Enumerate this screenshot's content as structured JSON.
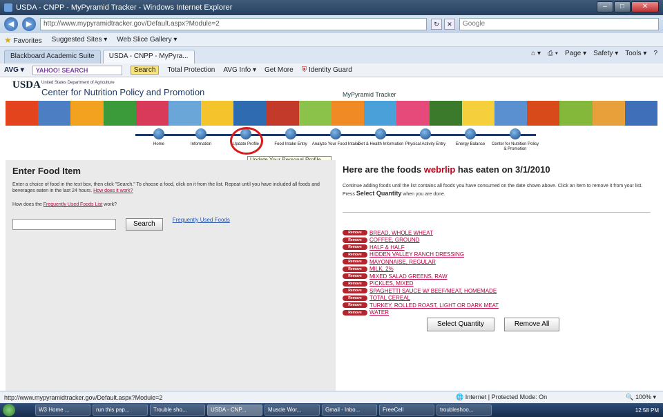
{
  "window": {
    "title": "USDA - CNPP - MyPyramid Tracker - Windows Internet Explorer"
  },
  "addressbar": {
    "url": "http://www.mypyramidtracker.gov/Default.aspx?Module=2",
    "search_placeholder": "Google"
  },
  "favorites": {
    "label": "Favorites",
    "items": [
      "Suggested Sites ▾",
      "Web Slice Gallery ▾"
    ]
  },
  "tabs": [
    {
      "label": "Blackboard Academic Suite"
    },
    {
      "label": "USDA - CNPP - MyPyra..."
    }
  ],
  "commands": [
    "Page ▾",
    "Safety ▾",
    "Tools ▾"
  ],
  "avg": {
    "logo": "AVG ▾",
    "yahoo": "YAHOO! SEARCH",
    "search": "Search",
    "items": [
      "Total Protection",
      "AVG Info ▾",
      "Get More",
      "Identity Guard"
    ]
  },
  "header": {
    "logo": "USDA",
    "dept": "United States Department of Agriculture",
    "org": "Center for Nutrition Policy and Promotion",
    "app": "MyPyramid Tracker"
  },
  "banner_colors": [
    "#e3441e",
    "#4c7ec4",
    "#f2a21f",
    "#3b9b3a",
    "#d93a5a",
    "#6aa6d8",
    "#f5c32c",
    "#2e6bb0",
    "#c43a2a",
    "#8bc34a",
    "#f08a24",
    "#4aa0d8",
    "#e64a7a",
    "#3b7a2a",
    "#f6d03c",
    "#5a8fd0",
    "#d94a1a",
    "#84b83a",
    "#e8a03a",
    "#3f6fb8"
  ],
  "steps": [
    "Home",
    "Information",
    "Update Profile",
    "Food Intake Entry",
    "Analyze Your Food Intake",
    "Diet & Health Information",
    "Physical Activity Entry",
    "Energy Balance",
    "Center for Nutrition Policy & Promotion"
  ],
  "tooltip": "Update Your Personal Profile",
  "left": {
    "title": "Enter Food Item",
    "instructions": "Enter a choice of food in the text box, then click \"Search.\" To choose a food, click on it from the list. Repeat until you have included all foods and beverages eaten in the last 24 hours.",
    "how_link": "How does it work?",
    "freq_q_pre": "How does the ",
    "freq_q_link": "Frequently Used Foods List",
    "freq_q_post": " work?",
    "search_value": "",
    "search_button": "Search",
    "freq_link": "Frequently Used Foods"
  },
  "right": {
    "title_pre": "Here are the foods ",
    "user": "webrlip",
    "title_post": " has eaten on 3/1/2010",
    "cont_text": "Continue adding foods until the list contains all foods you have consumed on the date shown above. Click an item to remove it from your list. Press",
    "cont_bold": "Select Quantity",
    "cont_end": "when you are done.",
    "remove_label": "Remove",
    "foods": [
      "BREAD, WHOLE WHEAT",
      "COFFEE, GROUND",
      "HALF & HALF",
      "HIDDEN VALLEY RANCH DRESSING",
      "MAYONNAISE, REGULAR",
      "MILK, 2%",
      "MIXED SALAD GREENS, RAW",
      "PICKLES, MIXED",
      "SPAGHETTI SAUCE W/ BEEF/MEAT, HOMEMADE",
      "TOTAL CEREAL",
      "TURKEY, ROLLED ROAST, LIGHT OR DARK MEAT",
      "WATER"
    ],
    "select_quantity": "Select Quantity",
    "remove_all": "Remove All"
  },
  "status": {
    "url": "http://www.mypyramidtracker.gov/Default.aspx?Module=2",
    "zone": "Internet | Protected Mode: On",
    "zoom": "100%"
  },
  "taskbar": {
    "tasks": [
      "W3 Home ...",
      "run this pap...",
      "Trouble sho...",
      "USDA - CNP...",
      "Muscle Wor...",
      "Gmail - Inbo...",
      "FreeCell",
      "troubleshoo..."
    ],
    "active_index": 3,
    "clock": "12:58 PM"
  }
}
